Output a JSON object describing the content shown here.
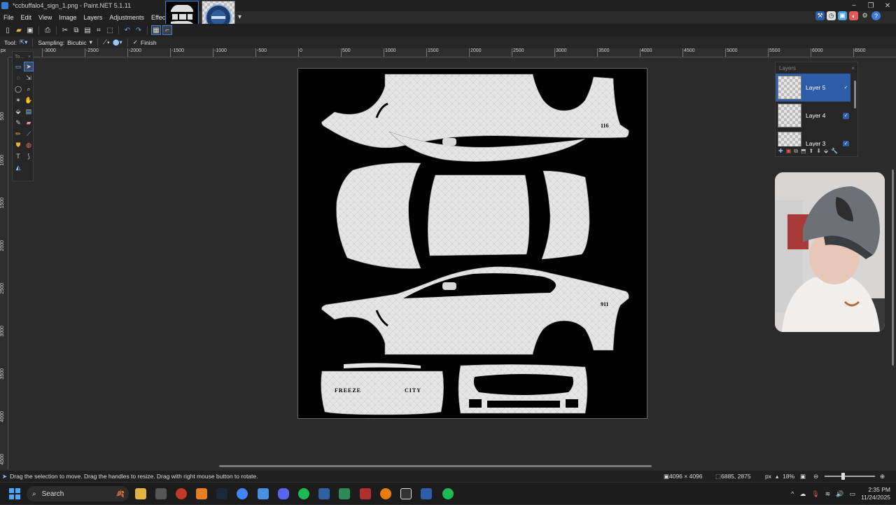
{
  "window": {
    "title": "*ccbuffalo4_sign_1.png - Paint.NET 5.1.11",
    "minimize": "−",
    "maximize": "❐",
    "close": "✕"
  },
  "menu": [
    "File",
    "Edit",
    "View",
    "Image",
    "Layers",
    "Adjustments",
    "Effects"
  ],
  "doc_thumbs": [
    "ccbuffalo4_sign_1.png",
    "freeze city logo"
  ],
  "tool_options": {
    "tool_label": "Tool:",
    "sampling_label": "Sampling:",
    "sampling_value": "Bicubic",
    "finish_label": "Finish"
  },
  "ruler": {
    "unit": "px",
    "h_ticks": [
      "-3000",
      "-2500",
      "-2000",
      "-1500",
      "-1000",
      "-500",
      "0",
      "500",
      "1000",
      "1500",
      "2000",
      "2500",
      "3000",
      "3500",
      "4000",
      "4500",
      "5000",
      "5500",
      "6000",
      "6500"
    ],
    "v_ticks": [
      "500",
      "1000",
      "1500",
      "2000",
      "2500",
      "3000",
      "3500",
      "4000",
      "4500"
    ]
  },
  "tools_window": {
    "title": "To..."
  },
  "layers_window": {
    "title": "Layers",
    "layers": [
      {
        "name": "Layer 5",
        "selected": true,
        "visible": true
      },
      {
        "name": "Layer 4",
        "selected": false,
        "visible": true
      },
      {
        "name": "Layer 3",
        "selected": false,
        "visible": true
      }
    ]
  },
  "canvas_text": {
    "number_top": "116",
    "number_side": "911",
    "rear_left": "FREEZE",
    "rear_right": "CITY"
  },
  "status": {
    "hint": "Drag the selection to move. Drag the handles to resize. Drag with right mouse button to rotate.",
    "image_size": "4096 × 4096",
    "cursor_pos": "6885, 2875",
    "units": "px",
    "zoom": "18%"
  },
  "taskbar": {
    "search_placeholder": "Search",
    "time": "2:35 PM",
    "date": "11/24/2025"
  },
  "colors": {
    "accent": "#2d5ca8",
    "canvas_bg": "#000000",
    "panel_fill": "#e6e6e6"
  }
}
